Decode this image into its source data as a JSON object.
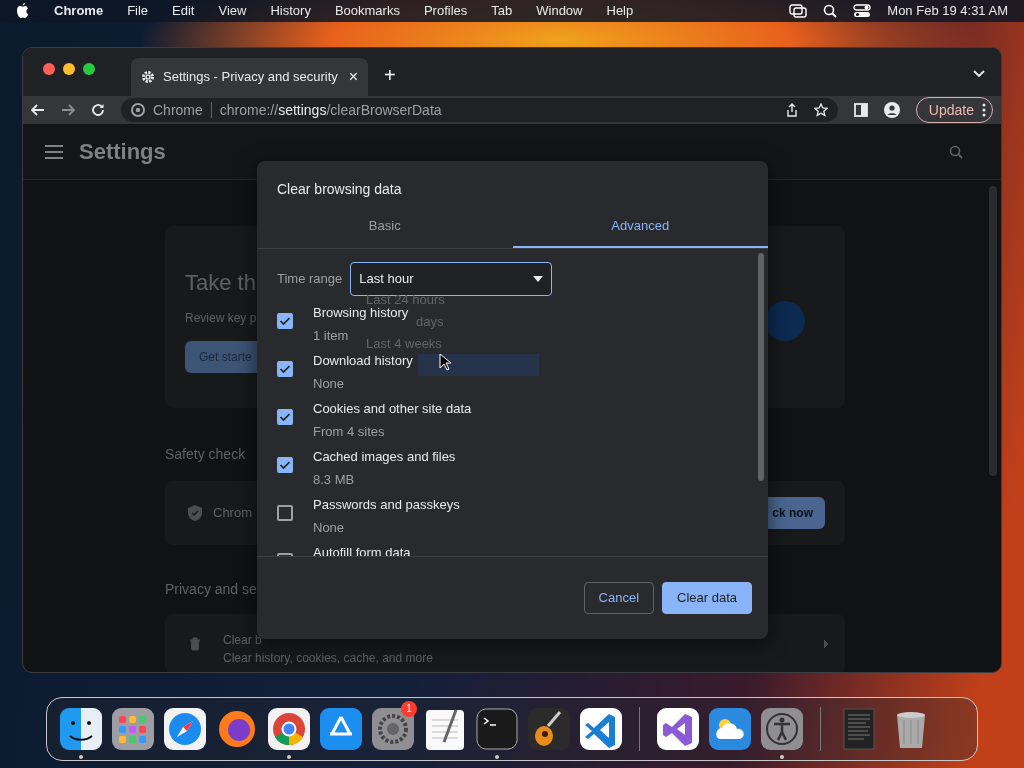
{
  "menubar": {
    "app": "Chrome",
    "menus": [
      "File",
      "Edit",
      "View",
      "History",
      "Bookmarks",
      "Profiles",
      "Tab",
      "Window",
      "Help"
    ],
    "clock": "Mon Feb 19  4:31 AM"
  },
  "browser": {
    "tab": {
      "title": "Settings - Privacy and security",
      "close": "×"
    },
    "new_tab": "+",
    "site_chip": "Chrome",
    "address": "chrome://**settings**/clearBrowserData",
    "update_button": "Update"
  },
  "settings": {
    "title": "Settings",
    "banner": {
      "title": "Take th",
      "text": "Review key p",
      "button": "Get starte"
    },
    "safety_heading": "Safety check",
    "safety_row": "Chrom",
    "safety_button": "ck now",
    "privacy_heading": "Privacy and se",
    "privacy_row": {
      "title": "Clear b",
      "text": "Clear history, cookies, cache, and more"
    }
  },
  "dialog": {
    "title": "Clear browsing data",
    "tabs": [
      {
        "label": "Basic",
        "selected": false
      },
      {
        "label": "Advanced",
        "selected": true
      }
    ],
    "time_range": {
      "label": "Time range",
      "value": "Last hour"
    },
    "menu_options": [
      {
        "label": "Last 24 hours",
        "selected": false
      },
      {
        "label": "days",
        "selected": false
      },
      {
        "label": "Last 4 weeks",
        "selected": false
      },
      {
        "selected": true
      }
    ],
    "items": [
      {
        "label": "Browsing history",
        "detail": "1 item",
        "checked": true
      },
      {
        "label": "Download history",
        "detail": "None",
        "checked": true
      },
      {
        "label": "Cookies and other site data",
        "detail": "From 4 sites",
        "checked": true
      },
      {
        "label": "Cached images and files",
        "detail": "8.3 MB",
        "checked": true
      },
      {
        "label": "Passwords and passkeys",
        "detail": "None",
        "checked": false
      },
      {
        "label": "Autofill form data",
        "checked": false
      }
    ],
    "buttons": [
      {
        "kind": "secondary",
        "label": "Cancel"
      },
      {
        "kind": "primary",
        "label": "Clear data"
      }
    ]
  },
  "dock": {
    "items": [
      {
        "kind": "finder",
        "running": true
      },
      {
        "kind": "launchpad",
        "running": false
      },
      {
        "kind": "safari",
        "running": false
      },
      {
        "kind": "firefox",
        "running": false
      },
      {
        "kind": "chrome",
        "running": true
      },
      {
        "kind": "appstore",
        "running": false
      },
      {
        "kind": "settings",
        "running": false,
        "badge": "1"
      },
      {
        "kind": "textedit",
        "running": false
      },
      {
        "kind": "terminal",
        "running": true
      },
      {
        "kind": "garageband",
        "running": false
      },
      {
        "kind": "vscode",
        "running": false
      },
      {
        "kind": "separator"
      },
      {
        "kind": "visualstudio",
        "running": false
      },
      {
        "kind": "weather",
        "running": false
      },
      {
        "kind": "accessibility",
        "running": true
      },
      {
        "kind": "separator"
      },
      {
        "kind": "document",
        "running": false
      },
      {
        "kind": "trash",
        "running": false
      }
    ]
  }
}
